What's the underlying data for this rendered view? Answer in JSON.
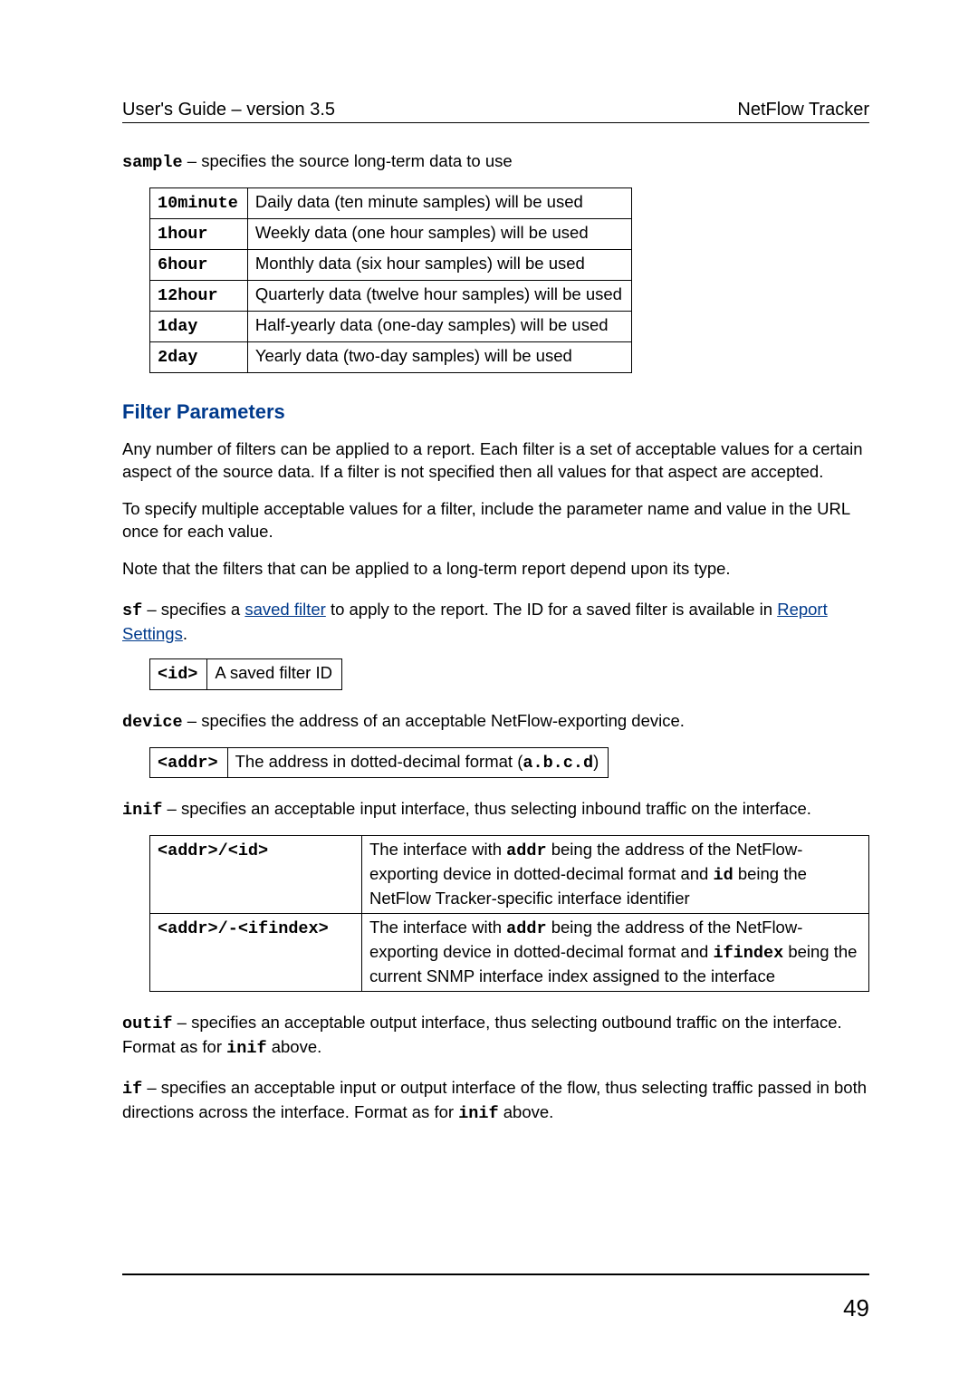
{
  "header": {
    "left": "User's Guide – version 3.5",
    "right": "NetFlow Tracker"
  },
  "sample": {
    "name": "sample",
    "dash": " – ",
    "desc": "specifies the source long-term data to use",
    "rows": [
      {
        "k": "10minute",
        "v": "Daily data (ten minute samples) will be used"
      },
      {
        "k": "1hour",
        "v": "Weekly data (one hour samples) will be used"
      },
      {
        "k": "6hour",
        "v": "Monthly data (six hour samples) will be used"
      },
      {
        "k": "12hour",
        "v": "Quarterly data (twelve hour samples) will be used"
      },
      {
        "k": "1day",
        "v": "Half-yearly data (one-day samples) will be used"
      },
      {
        "k": "2day",
        "v": "Yearly data (two-day samples) will be used"
      }
    ]
  },
  "section_title": "Filter Parameters",
  "intro": {
    "p1": "Any number of filters can be applied to a report. Each filter is a set of acceptable values for a certain aspect of the source data. If a filter is not specified then all values for that aspect are accepted.",
    "p2": "To specify multiple acceptable values for a filter, include the parameter name and value in the URL once for each value.",
    "p3": "Note that the filters that can be applied to a long-term report depend upon its type."
  },
  "sf": {
    "name": "sf",
    "dash": " – ",
    "pre": "specifies a ",
    "link1": "saved filter",
    "mid": " to apply to the report. The ID for a saved filter is available in ",
    "link2": "Report Settings",
    "post": ".",
    "rows": [
      {
        "k": "<id>",
        "v": "A saved filter ID"
      }
    ]
  },
  "device": {
    "name": "device",
    "dash": " – ",
    "desc": "specifies the address of an acceptable NetFlow-exporting device.",
    "rows": [
      {
        "k": "<addr>",
        "v_pre": "The address in dotted-decimal format (",
        "v_code": "a.b.c.d",
        "v_post": ")"
      }
    ]
  },
  "inif": {
    "name": "inif",
    "dash": " – ",
    "desc": "specifies an acceptable input interface, thus selecting inbound traffic on the interface.",
    "rows": [
      {
        "k": "<addr>/<id>",
        "t1": "The interface with ",
        "c1": "addr",
        "t2": " being the address of the NetFlow-exporting device in dotted-decimal format and ",
        "c2": "id",
        "t3": " being the NetFlow Tracker-specific interface identifier"
      },
      {
        "k": "<addr>/-<ifindex>",
        "t1": "The interface with ",
        "c1": "addr",
        "t2": " being the address of the NetFlow-exporting device in dotted-decimal format and ",
        "c2": "ifindex",
        "t3": " being the current SNMP interface index assigned to the interface"
      }
    ]
  },
  "outif": {
    "name": "outif",
    "dash": " – ",
    "t1": "specifies an acceptable output interface, thus selecting outbound traffic on the interface. Format as for ",
    "c1": "inif",
    "t2": " above."
  },
  "ifp": {
    "name": "if",
    "dash": " – ",
    "t1": "specifies an acceptable input or output interface of the flow, thus selecting traffic passed in both directions across the interface. Format as for ",
    "c1": "inif",
    "t2": " above."
  },
  "page_number": "49"
}
